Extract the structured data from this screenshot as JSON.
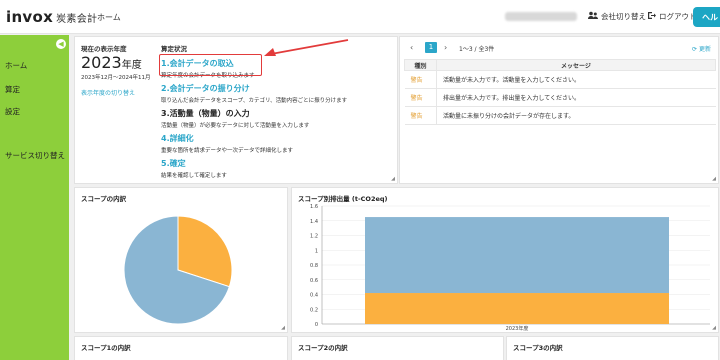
{
  "header": {
    "logo_main": "invox",
    "logo_sub": "炭素会計",
    "nav_home": "ホーム",
    "switch_company": "会社切り替え",
    "logout": "ログアウト",
    "help": "ヘル"
  },
  "sidebar": {
    "items": [
      {
        "label": "ホーム"
      },
      {
        "label": "算定"
      },
      {
        "label": "設定"
      },
      {
        "label": "サービス切り替え"
      }
    ]
  },
  "status_panel": {
    "fy_label": "現在の表示年度",
    "fy_year": "2023",
    "fy_unit": "年度",
    "fy_range": "2023年12月〜2024年11月",
    "fy_switch": "表示年度の切り替え",
    "heading": "算定状況",
    "steps": [
      {
        "title": "1.会計データの取込",
        "desc": "算定年度の会計データを取り込みます"
      },
      {
        "title": "2.会計データの振り分け",
        "desc": "取り込んだ会計データをスコープ、カテゴリ、活動内容ごとに振り分けます"
      },
      {
        "title": "3.活動量（物量）の入力",
        "desc": "活動量（物量）が必要なデータに対して活動量を入力します"
      },
      {
        "title": "4.詳細化",
        "desc": "重要な箇所を請求データや一次データで詳細化します"
      },
      {
        "title": "5.確定",
        "desc": "結果を確認して確定します"
      }
    ]
  },
  "messages": {
    "page": "1",
    "count": "1〜3 / 全3件",
    "refresh": "更新",
    "col_type": "種別",
    "col_message": "メッセージ",
    "rows": [
      {
        "type": "警告",
        "message": "活動量が未入力です。活動量を入力してください。"
      },
      {
        "type": "警告",
        "message": "排出量が未入力です。排出量を入力してください。"
      },
      {
        "type": "警告",
        "message": "活動量に未振り分けの会計データが存在します。"
      }
    ]
  },
  "scope_panel": {
    "title": "スコープの内訳"
  },
  "emission_panel": {
    "title": "スコープ別排出量 (t-CO2eq)"
  },
  "bottom_panels": {
    "scope1": "スコープ1の内訳",
    "scope2": "スコープ2の内訳",
    "scope3": "スコープ3の内訳"
  },
  "chart_data": [
    {
      "type": "pie",
      "title": "スコープの内訳",
      "slices": [
        {
          "value": 0.3,
          "color": "#fbb040"
        },
        {
          "value": 0.7,
          "color": "#8ab6d3"
        }
      ]
    },
    {
      "type": "bar",
      "title": "スコープ別排出量 (t-CO2eq)",
      "categories": [
        "2023年度"
      ],
      "stacked": true,
      "series": [
        {
          "values": [
            0.42
          ],
          "color": "#fbb040"
        },
        {
          "values": [
            1.03
          ],
          "color": "#8ab6d3"
        }
      ],
      "ylim": [
        0,
        1.6
      ],
      "yticks": [
        "0",
        "0.2",
        "0.4",
        "0.6",
        "0.8",
        "1",
        "1.2",
        "1.4",
        "1.6"
      ],
      "grid": true
    }
  ]
}
